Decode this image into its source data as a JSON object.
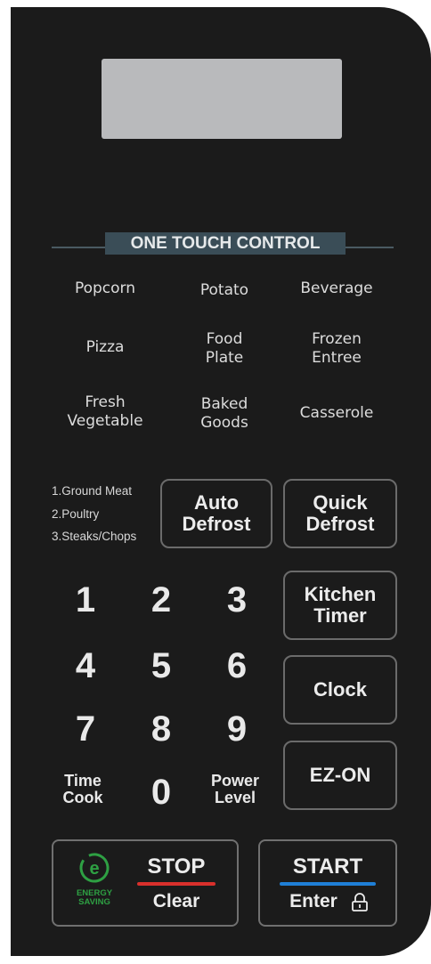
{
  "panel": {
    "section_title": "ONE TOUCH CONTROL",
    "one_touch": [
      "Popcorn",
      "Potato",
      "Beverage",
      "Pizza",
      "Food\nPlate",
      "Frozen\nEntree",
      "Fresh\nVegetable",
      "Baked\nGoods",
      "Casserole"
    ],
    "defrost_options": [
      "1.Ground Meat",
      "2.Poultry",
      "3.Steaks/Chops"
    ],
    "auto_defrost": "Auto\nDefrost",
    "quick_defrost": "Quick\nDefrost",
    "kitchen_timer": "Kitchen\nTimer",
    "clock": "Clock",
    "ez_on": "EZ-ON",
    "keypad": [
      "1",
      "2",
      "3",
      "4",
      "5",
      "6",
      "7",
      "8",
      "9",
      "0"
    ],
    "time_cook": "Time\nCook",
    "power_level": "Power\nLevel",
    "energy_saving": "ENERGY\nSAVING",
    "stop": "STOP",
    "clear": "Clear",
    "start": "START",
    "enter": "Enter",
    "colors": {
      "stop_bar": "#d9302c",
      "start_bar": "#1f7fd6",
      "energy_green": "#2ea043"
    }
  }
}
